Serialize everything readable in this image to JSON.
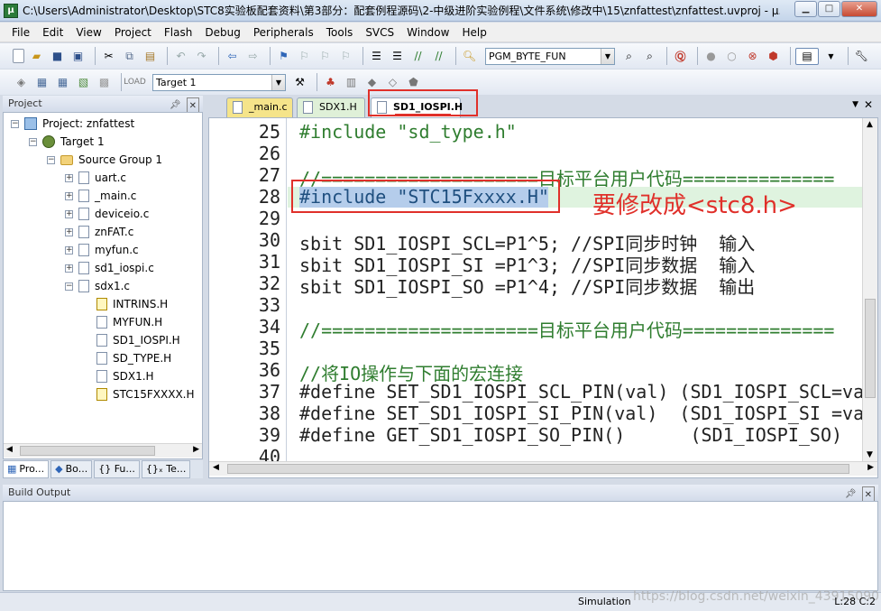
{
  "window": {
    "title": "C:\\Users\\Administrator\\Desktop\\STC8实验板配套资料\\第3部分：配套例程源码\\2-中级进阶实验例程\\文件系统\\修改中\\15\\znfattest\\znfattest.uvproj - µ..."
  },
  "menu": [
    "File",
    "Edit",
    "View",
    "Project",
    "Flash",
    "Debug",
    "Peripherals",
    "Tools",
    "SVCS",
    "Window",
    "Help"
  ],
  "toolbar": {
    "function_combo": "PGM_BYTE_FUN",
    "target_combo": "Target 1"
  },
  "project_panel": {
    "title": "Project",
    "tree": [
      {
        "label": "Project: znfattest",
        "depth": 0,
        "icon": "project-icon"
      },
      {
        "label": "Target 1",
        "depth": 1,
        "icon": "target-icon"
      },
      {
        "label": "Source Group 1",
        "depth": 2,
        "icon": "folder-icon"
      },
      {
        "label": "uart.c",
        "depth": 3,
        "icon": "file-icon"
      },
      {
        "label": "_main.c",
        "depth": 3,
        "icon": "file-icon"
      },
      {
        "label": "deviceio.c",
        "depth": 3,
        "icon": "file-icon"
      },
      {
        "label": "znFAT.c",
        "depth": 3,
        "icon": "file-icon"
      },
      {
        "label": "myfun.c",
        "depth": 3,
        "icon": "file-icon"
      },
      {
        "label": "sd1_iospi.c",
        "depth": 3,
        "icon": "file-icon"
      },
      {
        "label": "sdx1.c",
        "depth": 3,
        "icon": "file-icon"
      },
      {
        "label": "INTRINS.H",
        "depth": 4,
        "icon": "warning-file-icon"
      },
      {
        "label": "MYFUN.H",
        "depth": 4,
        "icon": "file-icon"
      },
      {
        "label": "SD1_IOSPI.H",
        "depth": 4,
        "icon": "file-icon"
      },
      {
        "label": "SD_TYPE.H",
        "depth": 4,
        "icon": "file-icon"
      },
      {
        "label": "SDX1.H",
        "depth": 4,
        "icon": "file-icon"
      },
      {
        "label": "STC15FXXXX.H",
        "depth": 4,
        "icon": "warning-file-icon"
      }
    ],
    "bottom_tabs": [
      "Pro...",
      "Bo...",
      "{} Fu...",
      "{}ₓ Te..."
    ]
  },
  "editor": {
    "tabs": [
      "_main.c",
      "SDX1.H",
      "SD1_IOSPI.H"
    ],
    "active_tab": "SD1_IOSPI.H",
    "lines": [
      {
        "n": "25",
        "text": "#include \"sd_type.h\""
      },
      {
        "n": "26",
        "text": ""
      },
      {
        "n": "27",
        "text": "//====================目标平台用户代码=============="
      },
      {
        "n": "28",
        "text": "#include \"STC15Fxxxx.H\""
      },
      {
        "n": "29",
        "text": ""
      },
      {
        "n": "30",
        "text": "sbit SD1_IOSPI_SCL=P1^5; //SPI同步时钟  输入"
      },
      {
        "n": "31",
        "text": "sbit SD1_IOSPI_SI =P1^3; //SPI同步数据  输入"
      },
      {
        "n": "32",
        "text": "sbit SD1_IOSPI_SO =P1^4; //SPI同步数据  输出"
      },
      {
        "n": "33",
        "text": ""
      },
      {
        "n": "34",
        "text": "//====================目标平台用户代码=============="
      },
      {
        "n": "35",
        "text": ""
      },
      {
        "n": "36",
        "text": "//将IO操作与下面的宏连接"
      },
      {
        "n": "37",
        "text": "#define SET_SD1_IOSPI_SCL_PIN(val) (SD1_IOSPI_SCL=va"
      },
      {
        "n": "38",
        "text": "#define SET_SD1_IOSPI_SI_PIN(val)  (SD1_IOSPI_SI =va"
      },
      {
        "n": "39",
        "text": "#define GET_SD1_IOSPI_SO_PIN()      (SD1_IOSPI_SO)"
      },
      {
        "n": "40",
        "text": ""
      }
    ],
    "annotation": "要修改成<stc8.h>"
  },
  "build_output": {
    "title": "Build Output"
  },
  "status": {
    "mode": "Simulation",
    "position": "L:28 C:2",
    "watermark": "https://blog.csdn.net/weixin_43915090"
  }
}
